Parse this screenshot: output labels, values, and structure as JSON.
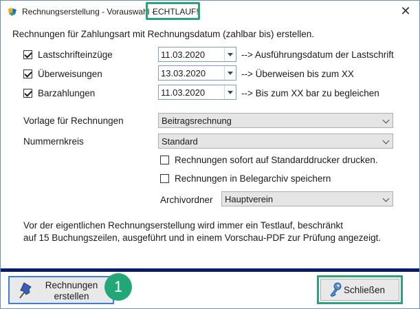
{
  "window": {
    "title": "Rechnungserstellung - Vorauswahl -",
    "title_mode": "ECHTLAUF!",
    "close_glyph": "✕"
  },
  "intro": "Rechnungen für Zahlungsart mit Rechnungsdatum (zahlbar bis) erstellen.",
  "payment_types": [
    {
      "label": "Lastschrifteinzüge",
      "checked": true,
      "date": "11.03.2020",
      "description": "--> Ausführungsdatum der Lastschrift"
    },
    {
      "label": "Überweisungen",
      "checked": true,
      "date": "13.03.2020",
      "description": "--> Überweisen bis zum XX"
    },
    {
      "label": "Barzahlungen",
      "checked": true,
      "date": "11.03.2020",
      "description": "--> Bis zum XX bar zu begleichen"
    }
  ],
  "template": {
    "label": "Vorlage für Rechnungen",
    "value": "Beitragsrechnung"
  },
  "number_range": {
    "label": "Nummernkreis",
    "value": "Standard"
  },
  "options": {
    "print": {
      "label": "Rechnungen sofort auf Standarddrucker drucken.",
      "checked": false
    },
    "archive": {
      "label": "Rechnungen in Belegarchiv speichern",
      "checked": false
    }
  },
  "archive_folder": {
    "label": "Archivordner",
    "value": "Hauptverein"
  },
  "info_lines": [
    "Vor der eigentlichen Rechnungserstellung wird immer ein Testlauf, beschränkt",
    "auf 15 Buchungszeilen, ausgeführt und in einem Vorschau-PDF zur Prüfung angezeigt."
  ],
  "buttons": {
    "create_line1": "Rechnungen",
    "create_line2": "erstellen",
    "close": "Schließen"
  },
  "badge": "1",
  "icons": {
    "app": "app-logo-icon",
    "create": "pushpin-icon",
    "close": "key-icon",
    "dropdown": "chevron-down-icon"
  },
  "colors": {
    "highlight": "#2aa37b",
    "footer_bar": "#0a1a6a",
    "focus_border": "#3c7fd9"
  }
}
